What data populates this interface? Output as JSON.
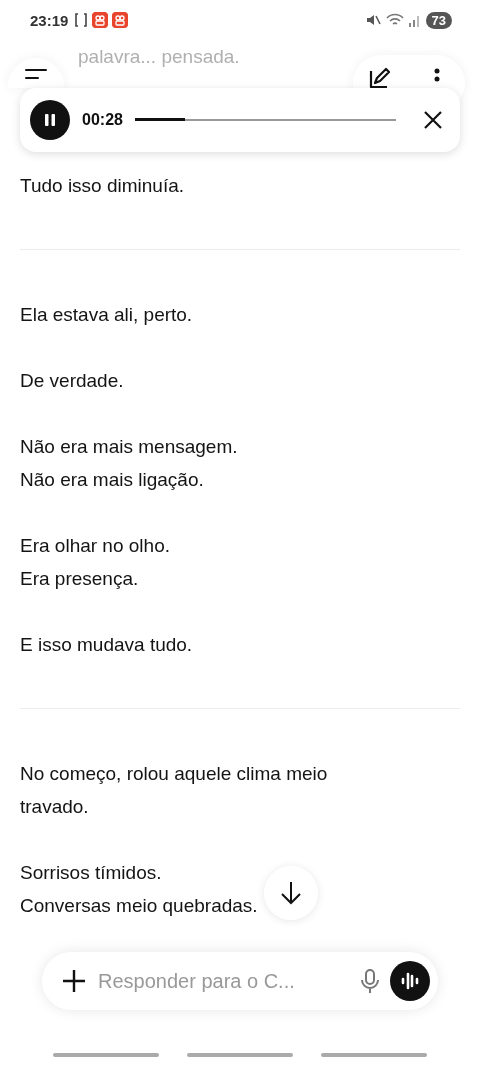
{
  "status_bar": {
    "time": "23:19",
    "battery": "73"
  },
  "top_partial_text": "palavra... pensada.",
  "audio_player": {
    "playing": true,
    "elapsed": "00:28",
    "level": 0.19
  },
  "sections": [
    {
      "paragraphs": [
        {
          "lines": [
            "Tudo isso diminuía."
          ]
        }
      ]
    },
    {
      "paragraphs": [
        {
          "lines": [
            "Ela estava ali, perto."
          ]
        },
        {
          "lines": [
            "De verdade."
          ]
        },
        {
          "lines": [
            "Não era mais mensagem.",
            "Não era mais ligação."
          ]
        },
        {
          "lines": [
            "Era olhar no olho.",
            "Era presença."
          ]
        },
        {
          "lines": [
            "E isso mudava tudo."
          ]
        }
      ]
    },
    {
      "paragraphs": [
        {
          "lines": [
            "No começo, rolou aquele clima meio",
            "travado."
          ]
        },
        {
          "lines": [
            "Sorrisos tímidos.",
            "Conversas meio quebradas."
          ]
        }
      ]
    }
  ],
  "composer": {
    "placeholder": "Responder para o C..."
  }
}
